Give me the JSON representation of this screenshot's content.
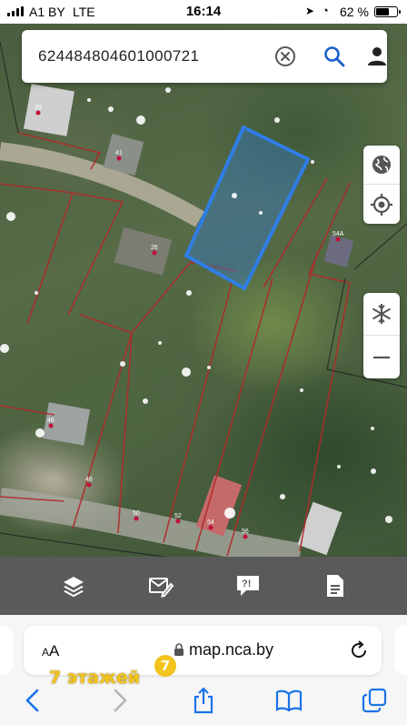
{
  "status_bar": {
    "carrier": "A1 BY",
    "network": "LTE",
    "time": "16:14",
    "battery_percent": "62 %",
    "battery_level": 0.62,
    "icons": [
      "signal-icon",
      "location-arrow-icon",
      "alarm-icon",
      "battery-icon"
    ]
  },
  "search": {
    "query": "624484804601000721",
    "icons": [
      "clear-icon",
      "search-icon",
      "user-icon"
    ]
  },
  "map": {
    "parcel_highlight_color": "#2f7ee6",
    "boundary_color": "#b02a2a",
    "labels": [
      "39",
      "41",
      "26",
      "54А",
      "46",
      "48",
      "50",
      "52",
      "54",
      "56"
    ],
    "controls": [
      "globe-icon",
      "locate-icon",
      "snowflake-icon",
      "zoom-out-icon"
    ]
  },
  "toolbar": {
    "items": [
      "layers-icon",
      "feedback-edit-icon",
      "report-issue-icon",
      "document-icon"
    ],
    "background": "#5a5a5a"
  },
  "browser": {
    "text_size_label": "AA",
    "url": "map.nca.by",
    "icons": [
      "lock-icon",
      "reload-icon",
      "back-icon",
      "forward-icon",
      "share-icon",
      "bookmarks-icon",
      "tabs-icon"
    ]
  },
  "watermark": {
    "text": "7 этажей",
    "badge": "7",
    "color": "#f2c41c"
  }
}
